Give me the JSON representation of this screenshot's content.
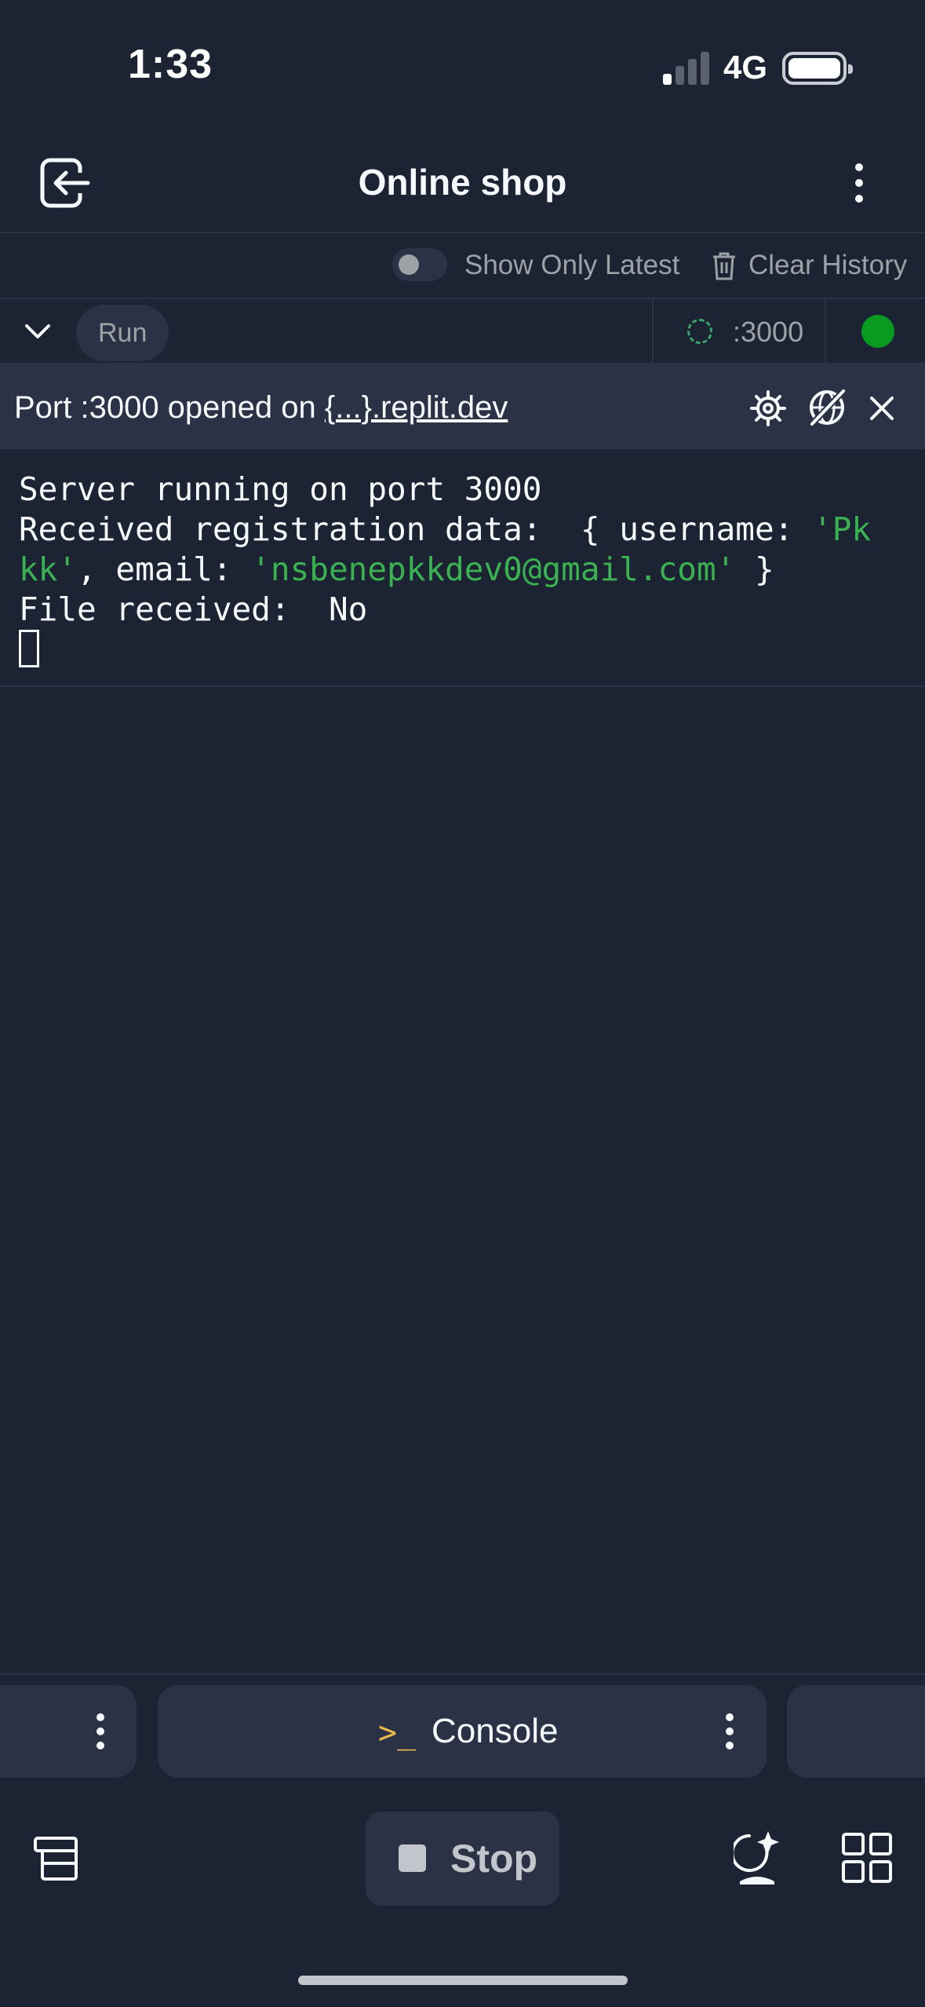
{
  "status_bar": {
    "time": "1:33",
    "network": "4G"
  },
  "header": {
    "title": "Online shop"
  },
  "toolbar": {
    "toggle_label": "Show Only Latest",
    "clear_label": "Clear History"
  },
  "run_row": {
    "run_label": "Run",
    "port_label": ":3000"
  },
  "banner": {
    "prefix": "Port :3000 opened on ",
    "link": "{...}.replit.dev"
  },
  "console": {
    "line1": "Server running on port 3000",
    "line2_a": "Received registration data:  { username: ",
    "line2_b": "'Pk",
    "line3_a": "kk'",
    "line3_b": ", email: ",
    "line3_c": "'nsbenepkkdev0@gmail.com'",
    "line3_d": " }",
    "line4": "File received:  No"
  },
  "tabs": {
    "console_icon": ">_",
    "console_label": "Console"
  },
  "bottom_bar": {
    "stop_label": "Stop"
  },
  "colors": {
    "background": "#1c2333",
    "panel": "#2b3245",
    "accent_green": "#3bb252",
    "status_green": "#0a9a22",
    "console_icon": "#e8b84a"
  }
}
